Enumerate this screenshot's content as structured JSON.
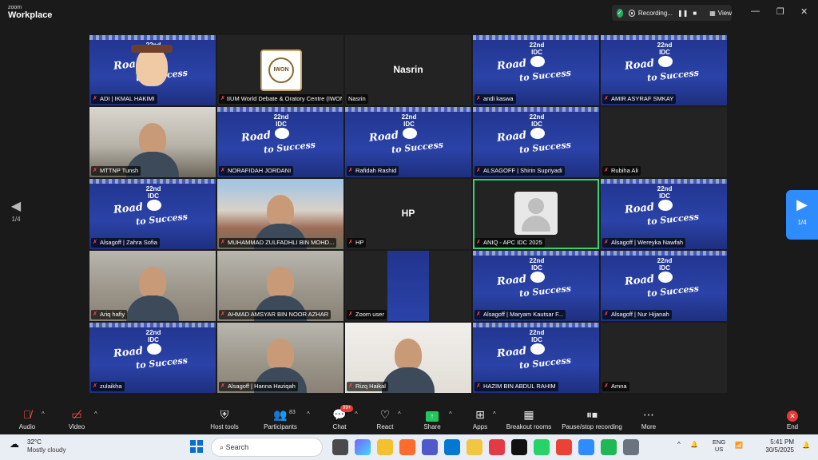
{
  "window": {
    "brand_small": "zoom",
    "brand_big": "Workplace",
    "recording_label": "Recording...",
    "pause_icon": "❚❚",
    "stop_icon": "■",
    "view_label": "View",
    "minimize": "—",
    "restore": "❐",
    "close": "✕"
  },
  "gallery": {
    "page_indicator": "1/4",
    "tiles": [
      {
        "name": "ADI | IKMAL HAKIMI",
        "muted": true,
        "kind": "avatar"
      },
      {
        "name": "IIUM World Debate & Oratory Centre (IWON)",
        "muted": true,
        "kind": "logo",
        "logo_text": "IWON"
      },
      {
        "name": "Nasrin",
        "muted": false,
        "kind": "nametext",
        "center": "Nasrin"
      },
      {
        "name": "andi kaswa",
        "muted": true,
        "kind": "banner"
      },
      {
        "name": "AMIR ASYRAF SMKAY",
        "muted": true,
        "kind": "banner"
      },
      {
        "name": "MTTNP Tunsh",
        "muted": true,
        "kind": "photo"
      },
      {
        "name": "NORAFIDAH JORDANI",
        "muted": true,
        "kind": "banner"
      },
      {
        "name": "Rafidah Rashid",
        "muted": true,
        "kind": "banner"
      },
      {
        "name": "ALSAGOFF | Shirin Supriyadi",
        "muted": true,
        "kind": "banner"
      },
      {
        "name": "Rubiha Ali",
        "muted": true,
        "kind": "dark"
      },
      {
        "name": "Alsagoff | Zahra Sofia",
        "muted": true,
        "kind": "banner"
      },
      {
        "name": "MUHAMMAD ZULFADHLI BIN MOHD...",
        "muted": true,
        "kind": "house"
      },
      {
        "name": "HP",
        "muted": true,
        "kind": "nametext",
        "center": "HP"
      },
      {
        "name": "ANIQ - APC IDC 2025",
        "muted": true,
        "kind": "placeholder"
      },
      {
        "name": "Alsagoff | Wereyka Nawfah",
        "muted": true,
        "kind": "banner"
      },
      {
        "name": "Ariq hafiy",
        "muted": true,
        "kind": "room"
      },
      {
        "name": "AHMAD AMSYAR BIN NOOR AZHAR",
        "muted": true,
        "kind": "room"
      },
      {
        "name": "Zoom user",
        "muted": true,
        "kind": "banner-small"
      },
      {
        "name": "Alsagoff | Maryam Kautsar F...",
        "muted": true,
        "kind": "banner"
      },
      {
        "name": "Alsagoff | Nur Hijanah",
        "muted": true,
        "kind": "banner"
      },
      {
        "name": "zulaikha",
        "muted": true,
        "kind": "banner"
      },
      {
        "name": "Alsagoff | Hanna Haziqah",
        "muted": true,
        "kind": "room"
      },
      {
        "name": "Rizq Haikal",
        "muted": true,
        "kind": "light"
      },
      {
        "name": "HAZIM BIN ABDUL RAHIM",
        "muted": true,
        "kind": "banner"
      },
      {
        "name": "Amna",
        "muted": true,
        "kind": "dark"
      }
    ],
    "banner_logo": "22nd IDC",
    "banner_road": "Road",
    "banner_succ": "to Success"
  },
  "toolbar": {
    "audio": "Audio",
    "video": "Video",
    "host_tools": "Host tools",
    "participants": "Participants",
    "participants_count": "83",
    "chat": "Chat",
    "chat_badge": "99+",
    "react": "React",
    "share": "Share",
    "apps": "Apps",
    "breakout": "Breakout rooms",
    "pause_stop": "Pause/stop recording",
    "more": "More",
    "end": "End"
  },
  "taskbar": {
    "temp": "32°C",
    "condition": "Mostly cloudy",
    "search_placeholder": "Search",
    "lang_top": "ENG",
    "lang_bottom": "US",
    "time": "5:41 PM",
    "date": "30/5/2025"
  },
  "colors": {
    "active_speaker": "#2ed573",
    "next_page": "#2f8cff",
    "banner_blue": "#2b43a8"
  }
}
